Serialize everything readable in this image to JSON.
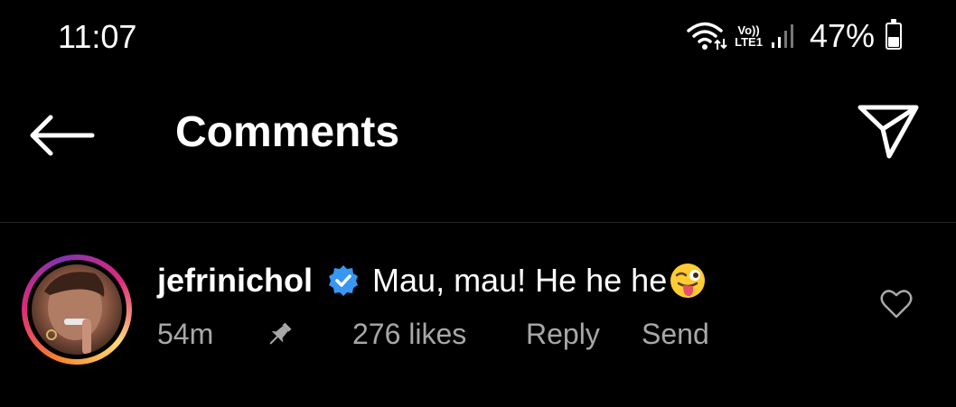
{
  "status_bar": {
    "time": "11:07",
    "volte_top": "Vo))",
    "volte_bottom": "LTE1",
    "battery_percent": "47%",
    "battery_level": 0.47,
    "icons": [
      "wifi-icon",
      "signal-icon",
      "battery-icon"
    ]
  },
  "header": {
    "title": "Comments",
    "back_icon": "arrow-left-icon",
    "share_icon": "paper-plane-icon"
  },
  "comment": {
    "username": "jefrinichol",
    "verified": true,
    "text": "Mau, mau! He he he",
    "emoji": "winking-face-with-tongue",
    "time_ago": "54m",
    "pinned": true,
    "likes": "276 likes",
    "reply_label": "Reply",
    "send_label": "Send",
    "like_icon": "heart-outline-icon"
  },
  "colors": {
    "background": "#000000",
    "text": "#ffffff",
    "secondary_text": "#a8a8a8",
    "verified_blue": "#3897f0",
    "divider": "#262626"
  }
}
